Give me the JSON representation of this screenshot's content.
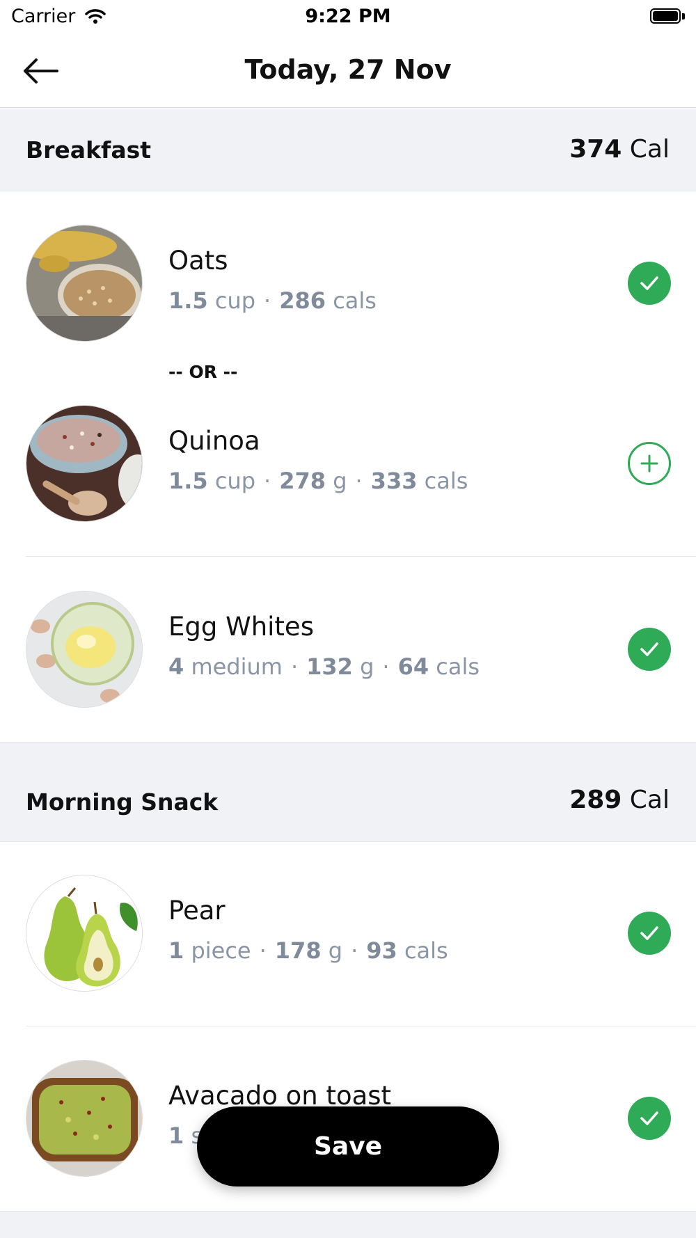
{
  "status_bar": {
    "carrier": "Carrier",
    "time": "9:22 PM"
  },
  "nav": {
    "title": "Today, 27 Nov"
  },
  "breakfast": {
    "title": "Breakfast",
    "cal_value": "374",
    "cal_unit": "Cal",
    "items": [
      {
        "name": "Oats",
        "qty": "1.5",
        "qty_unit": "cup",
        "weight": "",
        "weight_unit": "",
        "cals": "286",
        "cals_unit": "cals",
        "status": "checked"
      },
      {
        "name": "Quinoa",
        "qty": "1.5",
        "qty_unit": "cup",
        "weight": "278",
        "weight_unit": "g",
        "cals": "333",
        "cals_unit": "cals",
        "status": "add"
      },
      {
        "name": "Egg Whites",
        "qty": "4",
        "qty_unit": "medium",
        "weight": "132",
        "weight_unit": "g",
        "cals": "64",
        "cals_unit": "cals",
        "status": "checked"
      }
    ],
    "or_label": "-- OR --"
  },
  "morning_snack": {
    "title": "Morning Snack",
    "cal_value": "289",
    "cal_unit": "Cal",
    "items": [
      {
        "name": "Pear",
        "qty": "1",
        "qty_unit": "piece",
        "weight": "178",
        "weight_unit": "g",
        "cals": "93",
        "cals_unit": "cals",
        "status": "checked"
      },
      {
        "name": "Avacado on toast",
        "qty": "1",
        "qty_unit": "s",
        "status": "checked"
      }
    ]
  },
  "save_label": "Save",
  "colors": {
    "accent_green": "#2faa57",
    "section_bg": "#f0f2f5",
    "meta_gray": "#8a95a5"
  },
  "icons": {
    "back": "arrow-left-icon",
    "check": "check-icon",
    "add": "plus-circle-icon"
  }
}
